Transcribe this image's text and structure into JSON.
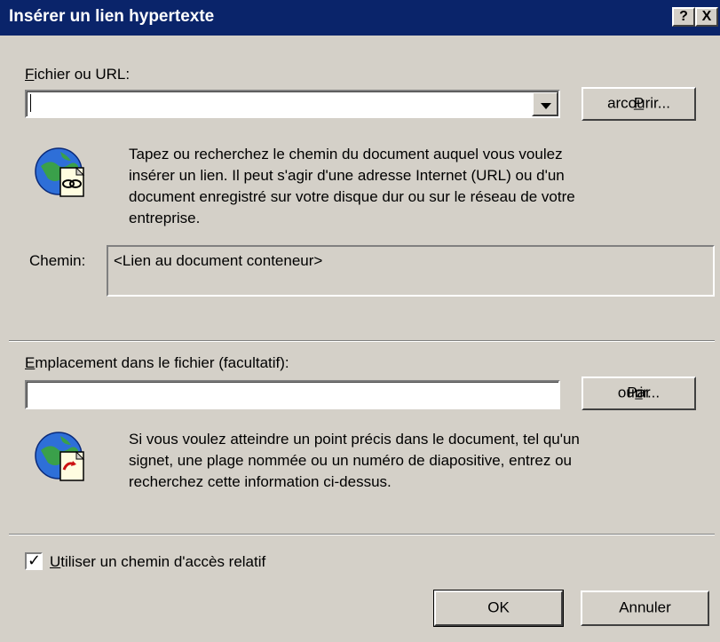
{
  "window": {
    "title": "Insérer un lien hypertexte",
    "help_btn": "?",
    "close_btn": "X"
  },
  "url_section": {
    "label_key": "F",
    "label_rest": "ichier ou URL:",
    "value": "",
    "browse": {
      "before": "",
      "key": "P",
      "after": "arcourir..."
    },
    "description": [
      "Tapez ou recherchez le chemin du document auquel vous voulez",
      "insérer un lien. Il peut s'agir d'une adresse Internet (URL) ou d'un",
      "document enregistré sur votre disque dur ou sur le réseau de votre",
      "entreprise."
    ],
    "icon": "globe-document-link-icon"
  },
  "path": {
    "label": "Chemin:",
    "value": "<Lien au document conteneur>"
  },
  "location_section": {
    "label_key": "E",
    "label_rest": "mplacement dans le fichier (facultatif):",
    "value": "",
    "browse": {
      "before": "Par",
      "key": "c",
      "after": "ourir..."
    },
    "description": [
      "Si vous voulez atteindre un point précis dans le document, tel qu'un",
      "signet, une plage nommée ou un numéro de diapositive, entrez ou",
      "recherchez cette information ci-dessus."
    ],
    "icon": "globe-document-bookmark-icon"
  },
  "relative_path": {
    "checked": true,
    "check_glyph": "✓",
    "label_key": "U",
    "label_rest": "tiliser un chemin d'accès relatif"
  },
  "buttons": {
    "ok": "OK",
    "cancel": "Annuler"
  }
}
